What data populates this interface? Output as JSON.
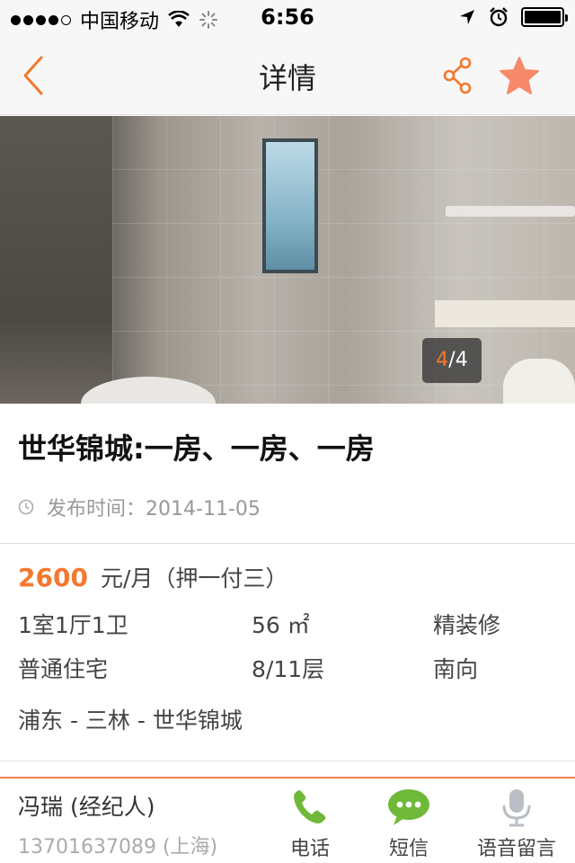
{
  "status_bar": {
    "carrier": "中国移动",
    "time": "6:56"
  },
  "nav": {
    "title": "详情",
    "back_icon": "chevron-left-icon",
    "share_icon": "share-icon",
    "favorite_icon": "star-icon"
  },
  "photo": {
    "current": "4",
    "separator": "/",
    "total": "4"
  },
  "listing": {
    "title": "世华锦城:一房、一房、一房",
    "publish_label": "发布时间：",
    "publish_date": "2014-11-05",
    "price": "2600",
    "price_unit": "元/月（押一付三）",
    "layout": "1室1厅1卫",
    "area": "56 ㎡",
    "decoration": "精装修",
    "type": "普通住宅",
    "floor": "8/11层",
    "orientation": "南向",
    "location": "浦东 - 三林 - 世华锦城"
  },
  "agent": {
    "name": "冯瑞 (经纪人)",
    "phone": "13701637089 (上海)"
  },
  "actions": {
    "call_label": "电话",
    "sms_label": "短信",
    "voice_label": "语音留言"
  },
  "colors": {
    "accent": "#f5772d",
    "action_green": "#6fb93a",
    "voice_gray": "#b8bec4"
  }
}
